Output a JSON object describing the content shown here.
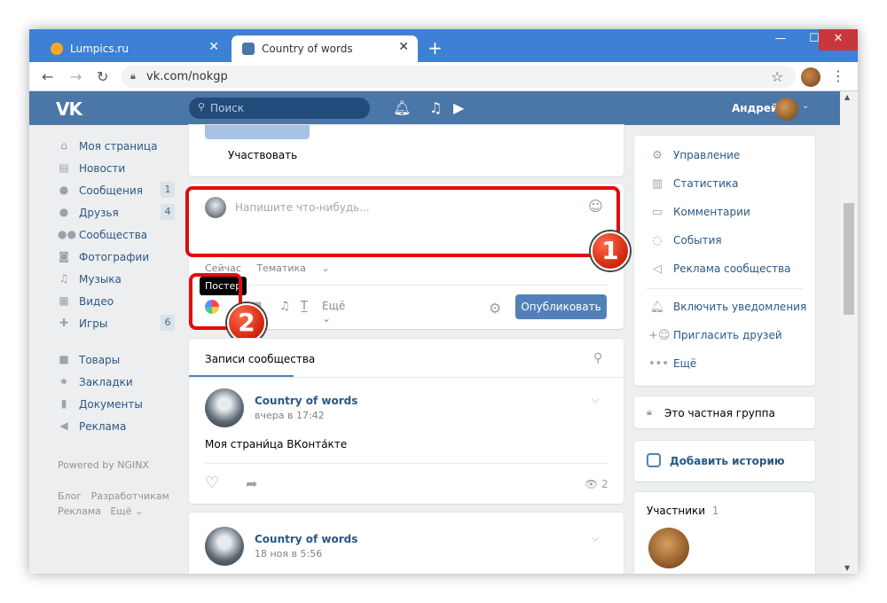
{
  "browser": {
    "tabs": [
      {
        "title": "Lumpics.ru",
        "active": false,
        "favicon_color": "#f5a623"
      },
      {
        "title": "Country of words",
        "active": true,
        "favicon_color": "#4a76a8"
      }
    ],
    "url": "vk.com/nokgp",
    "accent": "#3d80d5"
  },
  "vk": {
    "logo": "VK",
    "search_placeholder": "Поиск",
    "user_name": "Андрей",
    "brand_color": "#4a76a8"
  },
  "left_nav": {
    "items": [
      {
        "label": "Моя страница",
        "icon": "home-icon",
        "count": ""
      },
      {
        "label": "Новости",
        "icon": "news-icon",
        "count": ""
      },
      {
        "label": "Сообщения",
        "icon": "message-icon",
        "count": "1"
      },
      {
        "label": "Друзья",
        "icon": "user-icon",
        "count": "4"
      },
      {
        "label": "Сообщества",
        "icon": "users-icon",
        "count": ""
      },
      {
        "label": "Фотографии",
        "icon": "camera-icon",
        "count": ""
      },
      {
        "label": "Музыка",
        "icon": "music-icon",
        "count": ""
      },
      {
        "label": "Видео",
        "icon": "film-icon",
        "count": ""
      },
      {
        "label": "Игры",
        "icon": "gamepad-icon",
        "count": "6"
      }
    ],
    "items2": [
      {
        "label": "Товары",
        "icon": "bag-icon"
      },
      {
        "label": "Закладки",
        "icon": "star-icon"
      },
      {
        "label": "Документы",
        "icon": "document-icon"
      },
      {
        "label": "Реклама",
        "icon": "megaphone-icon"
      }
    ],
    "powered": "Powered by NGINX",
    "footer": [
      "Блог",
      "Разработчикам",
      "Реклама",
      "Ещё"
    ]
  },
  "top_card": {
    "participate": "Участвовать"
  },
  "composer": {
    "placeholder": "Напишите что-нибудь...",
    "when": "Сейчас",
    "topic": "Тематика",
    "more": "Ещё",
    "tooltip": "Постер",
    "publish": "Опубликовать"
  },
  "annotations": {
    "one": "1",
    "two": "2",
    "color": "#e10c0c"
  },
  "wall": {
    "tab": "Записи сообщества",
    "posts": [
      {
        "author": "Country of words",
        "date": "вчера в 17:42",
        "text": "Моя страни́ца ВКонта́кте",
        "views": "2"
      },
      {
        "author": "Country of words",
        "date": "18 ноя в 5:56"
      }
    ]
  },
  "right_menu": {
    "items": [
      {
        "label": "Управление",
        "icon": "gear-icon"
      },
      {
        "label": "Статистика",
        "icon": "stats-icon"
      },
      {
        "label": "Комментарии",
        "icon": "comment-icon"
      },
      {
        "label": "События",
        "icon": "event-icon"
      },
      {
        "label": "Реклама сообщества",
        "icon": "megaphone-icon"
      }
    ],
    "items2": [
      {
        "label": "Включить уведомления",
        "icon": "bell-icon"
      },
      {
        "label": "Пригласить друзей",
        "icon": "add-user-icon"
      },
      {
        "label": "Ещё",
        "icon": "more-icon"
      }
    ],
    "private": "Это частная группа",
    "story": "Добавить историю",
    "members_title": "Участники",
    "members_count": "1"
  }
}
